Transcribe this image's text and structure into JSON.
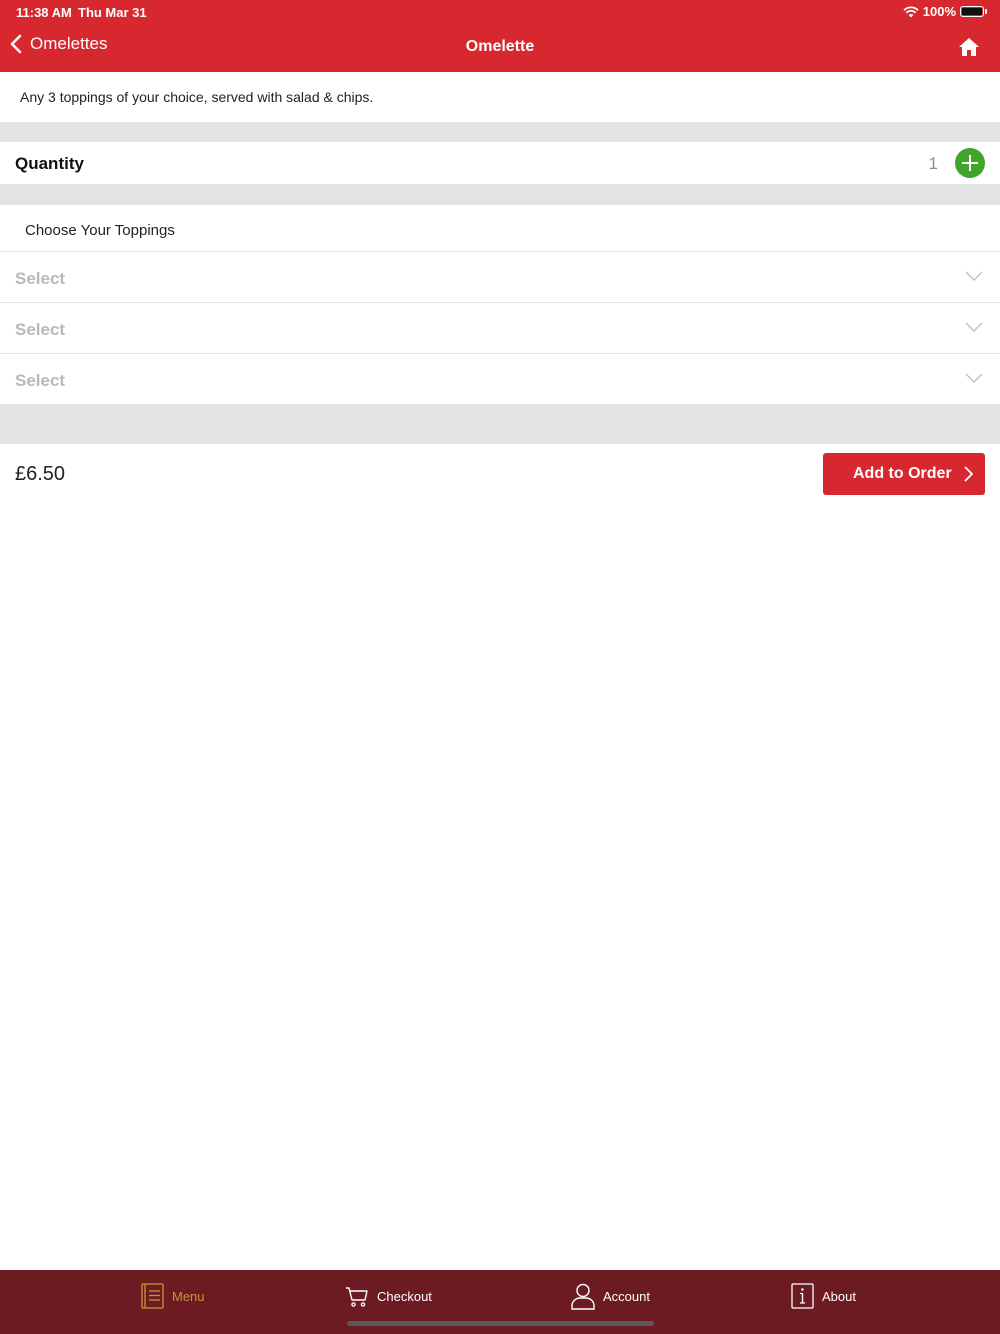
{
  "status_bar": {
    "time": "11:38 AM",
    "date": "Thu Mar 31",
    "battery": "100%"
  },
  "nav": {
    "back_label": "Omelettes",
    "title": "Omelette",
    "home_icon": "home-icon"
  },
  "product": {
    "description": "Any 3 toppings of your choice, served with salad & chips.",
    "quantity_label": "Quantity",
    "quantity_value": "1",
    "toppings_header": "Choose Your Toppings",
    "selects": [
      {
        "placeholder": "Select"
      },
      {
        "placeholder": "Select"
      },
      {
        "placeholder": "Select"
      }
    ],
    "price": "£6.50",
    "add_button_label": "Add to Order"
  },
  "tabbar": {
    "items": [
      {
        "label": "Menu",
        "icon": "menu-book-icon",
        "active": true
      },
      {
        "label": "Checkout",
        "icon": "cart-icon",
        "active": false
      },
      {
        "label": "Account",
        "icon": "user-icon",
        "active": false
      },
      {
        "label": "About",
        "icon": "info-icon",
        "active": false
      }
    ]
  },
  "colors": {
    "brand_red": "#d7282f",
    "tabbar_bg": "#6c1b22",
    "active_tab": "#c6973a",
    "add_green": "#3fa52b"
  }
}
